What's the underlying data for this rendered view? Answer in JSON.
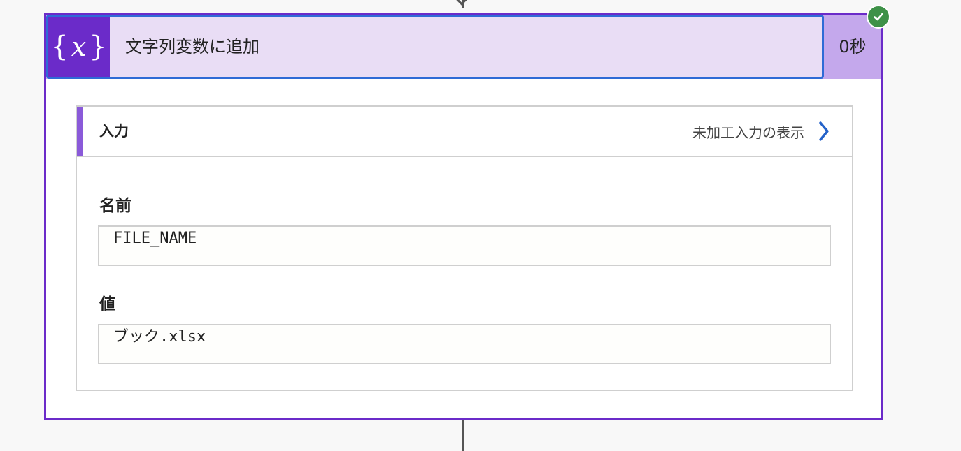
{
  "step": {
    "title": "文字列変数に追加",
    "duration": "0秒",
    "status": "succeeded",
    "icon": "variable-braces-icon",
    "colors": {
      "accent": "#6b2bc9",
      "header_bg": "#e9ddf5",
      "selection_border": "#2f6bd6",
      "success": "#3e9148"
    }
  },
  "inputs": {
    "title": "入力",
    "raw_link": "未加工入力の表示",
    "fields": [
      {
        "label": "名前",
        "value": "FILE_NAME"
      },
      {
        "label": "値",
        "value": "ブック.xlsx"
      }
    ]
  }
}
